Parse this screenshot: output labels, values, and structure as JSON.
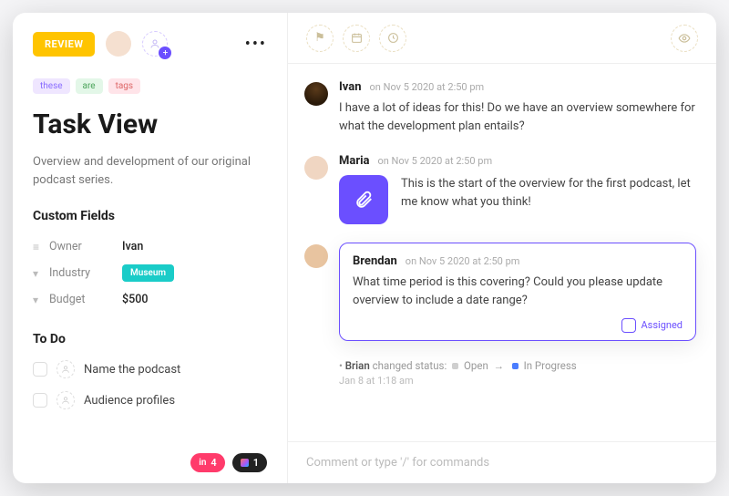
{
  "header": {
    "status_label": "REVIEW"
  },
  "tags": [
    "these",
    "are",
    "tags"
  ],
  "task": {
    "title": "Task View",
    "description": "Overview and development of our original podcast series."
  },
  "custom_fields": {
    "heading": "Custom Fields",
    "rows": [
      {
        "icon": "≡",
        "label": "Owner",
        "value": "Ivan",
        "type": "text"
      },
      {
        "icon": "▾",
        "label": "Industry",
        "value": "Museum",
        "type": "badge"
      },
      {
        "icon": "▾",
        "label": "Budget",
        "value": "$500",
        "type": "text"
      }
    ]
  },
  "todo": {
    "heading": "To Do",
    "items": [
      "Name the podcast",
      "Audience profiles"
    ]
  },
  "footer_pills": {
    "a_count": "4",
    "b_count": "1"
  },
  "comments": [
    {
      "author": "Ivan",
      "timestamp": "on Nov 5 2020 at 2:50 pm",
      "body": "I have a lot of ideas for this! Do we have an overview somewhere for what the development plan entails?"
    },
    {
      "author": "Maria",
      "timestamp": "on Nov 5 2020 at 2:50 pm",
      "body": "This is the start of the overview for the first podcast, let me know what you think!",
      "attachment": true
    },
    {
      "author": "Brendan",
      "timestamp": "on Nov 5 2020 at 2:50 pm",
      "body": "What time period is this covering? Could you please update overview to include a date range?",
      "highlighted": true
    }
  ],
  "assigned_label": "Assigned",
  "activity": {
    "actor": "Brian",
    "verb": "changed status:",
    "from": "Open",
    "to": "In Progress",
    "from_color": "#cfcfcf",
    "to_color": "#4a7dff",
    "timestamp": "Jan 8 at 1:18 am"
  },
  "composer": {
    "placeholder": "Comment or type '/' for commands"
  }
}
